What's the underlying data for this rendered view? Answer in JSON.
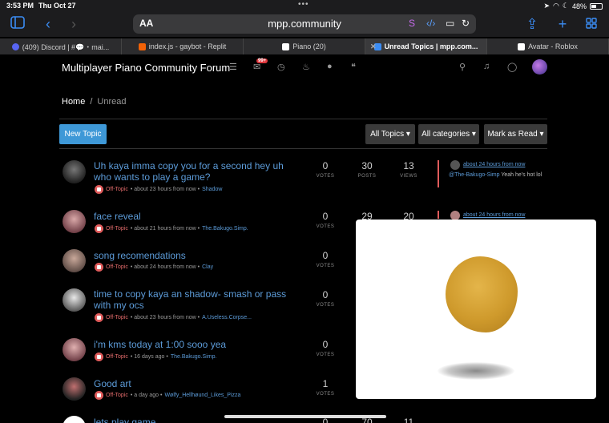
{
  "status_bar": {
    "time": "3:53 PM",
    "date": "Thu Oct 27",
    "battery": "48%"
  },
  "browser": {
    "text_size_button": "AA",
    "url": "mpp.community",
    "tabs": [
      {
        "label": "(409) Discord | #💬・mai...",
        "fav_color": "#5865f2"
      },
      {
        "label": "index.js - gaybot - Replit",
        "fav_color": "#f26207"
      },
      {
        "label": "Piano (20)",
        "fav_color": "#ffffff"
      },
      {
        "label": "Unread Topics | mpp.com...",
        "fav_color": "#3b8df5",
        "active": true
      },
      {
        "label": "Avatar - Roblox",
        "fav_color": "#ffffff"
      }
    ]
  },
  "forum": {
    "title": "Multiplayer Piano Community Forum",
    "notifications_badge": "99+",
    "breadcrumb": {
      "home": "Home",
      "separator": "/",
      "current": "Unread"
    },
    "buttons": {
      "new_topic": "New Topic",
      "all_topics": "All Topics ▾",
      "all_categories": "All categories ▾",
      "mark_read": "Mark as Read ▾"
    },
    "labels": {
      "votes": "VOTES",
      "posts": "POSTS",
      "views": "VIEWS"
    },
    "topics": [
      {
        "title": "Uh kaya imma copy you for a second hey uh who wants to play a game?",
        "category": "Off-Topic",
        "time": "• about 23 hours from now •",
        "user": "Shadow",
        "votes": "0",
        "posts": "30",
        "views": "13",
        "last_time": "about 24 hours from now",
        "last_mention": "@The-Bakugo-Simp",
        "last_text": " Yeah he's hot lol"
      },
      {
        "title": "face reveal",
        "category": "Off-Topic",
        "time": "• about 21 hours from now •",
        "user": "The.Bakugo.Simp.",
        "votes": "0",
        "posts": "29",
        "views": "20",
        "last_time": "about 24 hours from now"
      },
      {
        "title": "song recomendations",
        "category": "Off-Topic",
        "time": "• about 24 hours from now •",
        "user": "Clay",
        "votes": "0"
      },
      {
        "title": "time to copy kaya an shadow- smash or pass with my ocs",
        "category": "Off-Topic",
        "time": "• about 23 hours from now •",
        "user": "A.Useless.Corpse...",
        "votes": "0"
      },
      {
        "title": "i'm kms today at 1:00 sooo yea",
        "category": "Off-Topic",
        "time": "• 16 days ago •",
        "user": "The.Bakugo.Simp.",
        "votes": "0"
      },
      {
        "title": "Good art",
        "category": "Off-Topic",
        "time": "• a day ago •",
        "user": "Wølfy_Hellhøund_Likes_Pizza",
        "votes": "1"
      },
      {
        "title": "lets play game",
        "votes": "0",
        "posts": "70",
        "views": "11"
      }
    ]
  },
  "colors": {
    "accent": "#3e98d7",
    "link": "#5c9bd8",
    "category": "#e05b5b"
  },
  "popup_image": "chicken-nugget"
}
